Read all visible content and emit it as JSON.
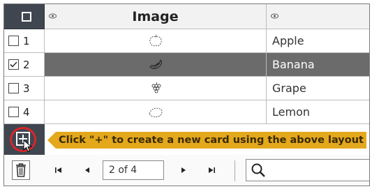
{
  "header": {
    "image_column_title": "Image",
    "first_column_icon": "eye-icon",
    "second_column_icon": "eye-icon"
  },
  "rows": [
    {
      "number": "1",
      "fruit": "Apple",
      "checked": false,
      "thumbnail": "apple-sketch"
    },
    {
      "number": "2",
      "fruit": "Banana",
      "checked": true,
      "thumbnail": "banana-sketch"
    },
    {
      "number": "3",
      "fruit": "Grape",
      "checked": false,
      "thumbnail": "grape-sketch"
    },
    {
      "number": "4",
      "fruit": "Lemon",
      "checked": false,
      "thumbnail": "lemon-sketch"
    }
  ],
  "add_strip": {
    "hint": "Click \"+\" to create a new card using the above layout",
    "highlight_color": "#d8262b",
    "banner_color": "#e3a81c"
  },
  "footer": {
    "page_indicator": "2 of 4",
    "search_placeholder": ""
  },
  "colors": {
    "dark_header": "#3f4650",
    "selected_row": "#6b6b6b"
  }
}
